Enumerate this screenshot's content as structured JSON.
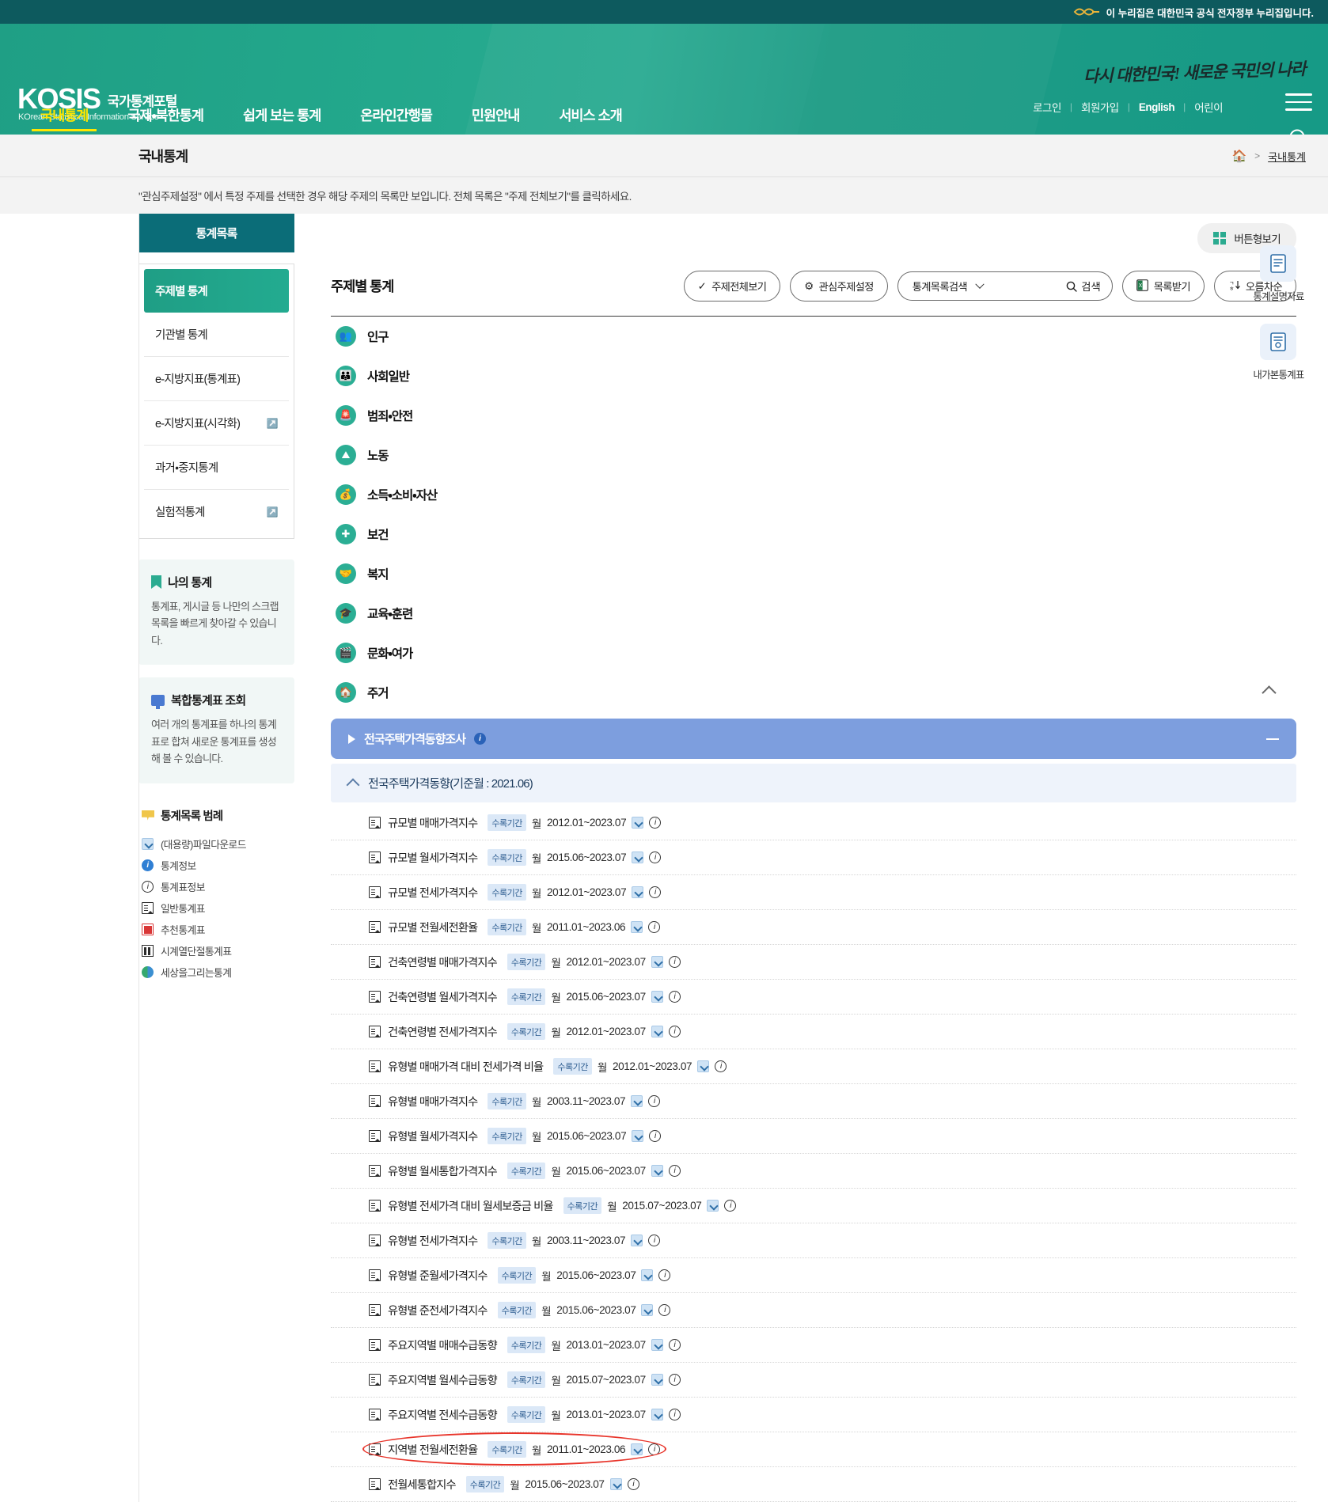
{
  "gov_bar": {
    "logo_text": "eG",
    "notice": "이 누리집은 대한민국 공식 전자정부 누리집입니다."
  },
  "header": {
    "logo_main": "KOSIS",
    "logo_sub_ko": "국가통계포털",
    "logo_sub_en": "KOrean Statistical Information Service",
    "slogan": "다시 대한민국! 새로운 국민의 나라",
    "util_links": [
      {
        "label": "로그인"
      },
      {
        "label": "회원가입"
      },
      {
        "label": "English"
      },
      {
        "label": "어린이"
      }
    ],
    "nav": [
      {
        "label": "국내통계",
        "active": true
      },
      {
        "label": "국제・북한통계",
        "active": false
      },
      {
        "label": "쉽게 보는 통계",
        "active": false
      },
      {
        "label": "온라인간행물",
        "active": false
      },
      {
        "label": "민원안내",
        "active": false
      },
      {
        "label": "서비스 소개",
        "active": false
      }
    ]
  },
  "subheader": {
    "page_title": "국내통계",
    "breadcrumb": {
      "home_icon": "home-icon",
      "separator": ">",
      "current": "국내통계"
    },
    "notice": "\"관심주제설정\" 에서 특정 주제를 선택한 경우 해당 주제의 목록만 보입니다. 전체 목록은 \"주제 전체보기\"를 클릭하세요."
  },
  "sidebar": {
    "head_label": "통계목록",
    "menu": [
      {
        "label": "주제별 통계",
        "active": true,
        "external": false
      },
      {
        "label": "기관별 통계",
        "active": false,
        "external": false
      },
      {
        "label": "e-지방지표(통계표)",
        "active": false,
        "external": false
      },
      {
        "label": "e-지방지표(시각화)",
        "active": false,
        "external": true
      },
      {
        "label": "과거・중지통계",
        "active": false,
        "external": false
      },
      {
        "label": "실험적통계",
        "active": false,
        "external": true
      }
    ],
    "promos": [
      {
        "icon": "bookmark-icon",
        "title": "나의 통계",
        "text": "통계표, 게시글 등 나만의 스크랩 목록을 빠르게 찾아갈 수 있습니다."
      },
      {
        "icon": "monitor-icon",
        "title": "복합통계표 조회",
        "text": "여러 개의 통계표를 하나의 통계표로 합쳐 새로운 통계표를 생성해 볼 수 있습니다."
      }
    ],
    "legend": {
      "title": "통계목록 범례",
      "items": [
        {
          "icon": "file-download-icon",
          "label": "(대용량)파일다운로드"
        },
        {
          "icon": "info-filled-icon",
          "label": "통계정보"
        },
        {
          "icon": "info-outline-icon",
          "label": "통계표정보"
        },
        {
          "icon": "general-table-icon",
          "label": "일반통계표"
        },
        {
          "icon": "recommended-table-icon",
          "label": "추천통계표"
        },
        {
          "icon": "timeseries-break-icon",
          "label": "시계열단절통계표"
        },
        {
          "icon": "globe-icon",
          "label": "세상을그리는통계"
        }
      ]
    }
  },
  "main": {
    "view_toggle": {
      "icon": "grid-icon",
      "label": "버튼형보기"
    },
    "toolbar": {
      "title": "주제별 통계",
      "buttons": [
        {
          "icon": "check-icon",
          "label": "주제전체보기"
        },
        {
          "icon": "gear-icon",
          "label": "관심주제설정"
        }
      ],
      "search": {
        "select_value": "통계목록검색",
        "input_value": "",
        "placeholder": "",
        "search_label": "검색"
      },
      "right_buttons": [
        {
          "icon": "excel-icon",
          "label": "목록받기"
        },
        {
          "icon": "sort-icon",
          "label": "오름차순"
        }
      ]
    },
    "topics": [
      {
        "icon": "population-icon",
        "label": "인구",
        "expanded": false
      },
      {
        "icon": "society-icon",
        "label": "사회일반",
        "expanded": false
      },
      {
        "icon": "crime-safety-icon",
        "label": "범죄・안전",
        "expanded": false
      },
      {
        "icon": "labor-icon",
        "label": "노동",
        "expanded": false
      },
      {
        "icon": "income-icon",
        "label": "소득・소비・자산",
        "expanded": false
      },
      {
        "icon": "health-icon",
        "label": "보건",
        "expanded": false
      },
      {
        "icon": "welfare-icon",
        "label": "복지",
        "expanded": false
      },
      {
        "icon": "education-icon",
        "label": "교육・훈련",
        "expanded": false
      },
      {
        "icon": "culture-icon",
        "label": "문화・여가",
        "expanded": false
      },
      {
        "icon": "housing-icon",
        "label": "주거",
        "expanded": true
      }
    ],
    "survey_bar": {
      "label": "전국주택가격동향조사",
      "info_icon": "info-filled-icon",
      "collapse_icon": "minus-icon"
    },
    "group_bar": {
      "label": "전국주택가격동향(기준월 : 2021.06)",
      "caret": "chevron-up-icon"
    },
    "period_badge_label": "수록기간",
    "stat_rows": [
      {
        "name": "규모별 매매가격지수",
        "unit": "월",
        "period": "2012.01~2023.07",
        "download": true,
        "info": true,
        "highlighted": false
      },
      {
        "name": "규모별 월세가격지수",
        "unit": "월",
        "period": "2015.06~2023.07",
        "download": true,
        "info": true,
        "highlighted": false
      },
      {
        "name": "규모별 전세가격지수",
        "unit": "월",
        "period": "2012.01~2023.07",
        "download": true,
        "info": true,
        "highlighted": false
      },
      {
        "name": "규모별 전월세전환율",
        "unit": "월",
        "period": "2011.01~2023.06",
        "download": true,
        "info": true,
        "highlighted": false
      },
      {
        "name": "건축연령별 매매가격지수",
        "unit": "월",
        "period": "2012.01~2023.07",
        "download": true,
        "info": true,
        "highlighted": false
      },
      {
        "name": "건축연령별 월세가격지수",
        "unit": "월",
        "period": "2015.06~2023.07",
        "download": true,
        "info": true,
        "highlighted": false
      },
      {
        "name": "건축연령별 전세가격지수",
        "unit": "월",
        "period": "2012.01~2023.07",
        "download": true,
        "info": true,
        "highlighted": false
      },
      {
        "name": "유형별 매매가격 대비 전세가격 비율",
        "unit": "월",
        "period": "2012.01~2023.07",
        "download": true,
        "info": true,
        "highlighted": false
      },
      {
        "name": "유형별 매매가격지수",
        "unit": "월",
        "period": "2003.11~2023.07",
        "download": true,
        "info": true,
        "highlighted": false
      },
      {
        "name": "유형별 월세가격지수",
        "unit": "월",
        "period": "2015.06~2023.07",
        "download": true,
        "info": true,
        "highlighted": false
      },
      {
        "name": "유형별 월세통합가격지수",
        "unit": "월",
        "period": "2015.06~2023.07",
        "download": true,
        "info": true,
        "highlighted": false
      },
      {
        "name": "유형별 전세가격 대비 월세보증금 비율",
        "unit": "월",
        "period": "2015.07~2023.07",
        "download": true,
        "info": true,
        "highlighted": false
      },
      {
        "name": "유형별 전세가격지수",
        "unit": "월",
        "period": "2003.11~2023.07",
        "download": true,
        "info": true,
        "highlighted": false
      },
      {
        "name": "유형별 준월세가격지수",
        "unit": "월",
        "period": "2015.06~2023.07",
        "download": true,
        "info": true,
        "highlighted": false
      },
      {
        "name": "유형별 준전세가격지수",
        "unit": "월",
        "period": "2015.06~2023.07",
        "download": true,
        "info": true,
        "highlighted": false
      },
      {
        "name": "주요지역별 매매수급동향",
        "unit": "월",
        "period": "2013.01~2023.07",
        "download": true,
        "info": true,
        "highlighted": false
      },
      {
        "name": "주요지역별 월세수급동향",
        "unit": "월",
        "period": "2015.07~2023.07",
        "download": true,
        "info": true,
        "highlighted": false
      },
      {
        "name": "주요지역별 전세수급동향",
        "unit": "월",
        "period": "2013.01~2023.07",
        "download": true,
        "info": true,
        "highlighted": false
      },
      {
        "name": "지역별 전월세전환율",
        "unit": "월",
        "period": "2011.01~2023.06",
        "download": true,
        "info": true,
        "highlighted": true
      },
      {
        "name": "전월세통합지수",
        "unit": "월",
        "period": "2015.06~2023.07",
        "download": true,
        "info": true,
        "highlighted": false
      }
    ]
  },
  "float_buttons": [
    {
      "icon": "doc-info-icon",
      "label": "통계설명자료"
    },
    {
      "icon": "viewed-table-icon",
      "label": "내가본통계표"
    }
  ]
}
